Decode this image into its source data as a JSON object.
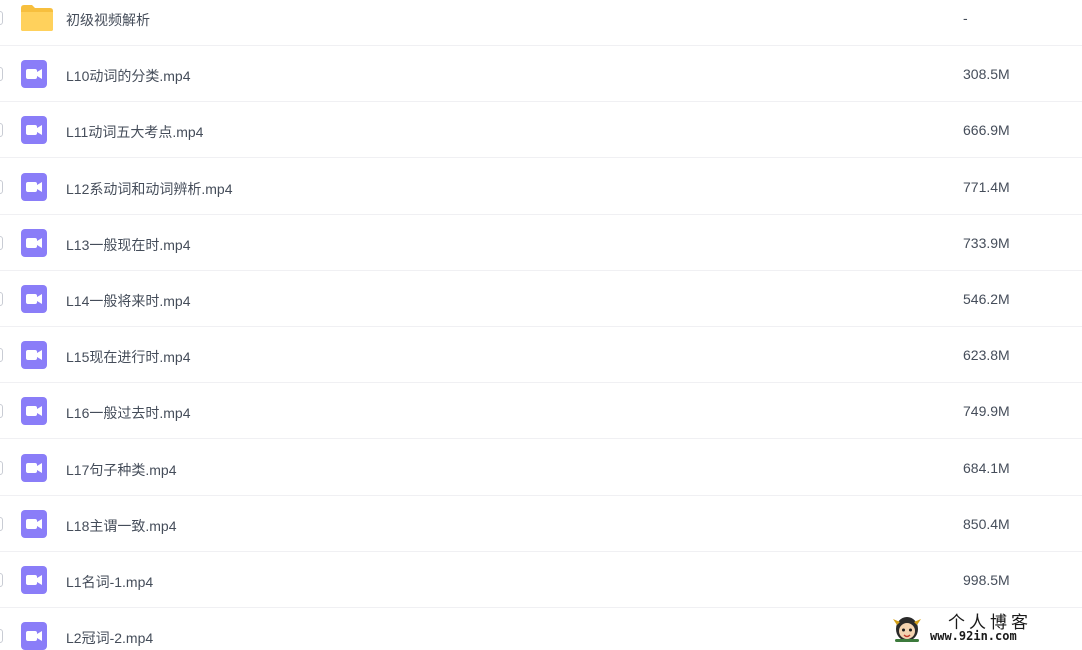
{
  "files": [
    {
      "name": "初级视频解析",
      "size": "-",
      "type": "folder",
      "icon": "folder-icon"
    },
    {
      "name": "L10动词的分类.mp4",
      "size": "308.5M",
      "type": "video",
      "icon": "video-file-icon"
    },
    {
      "name": "L11动词五大考点.mp4",
      "size": "666.9M",
      "type": "video",
      "icon": "video-file-icon"
    },
    {
      "name": "L12系动词和动词辨析.mp4",
      "size": "771.4M",
      "type": "video",
      "icon": "video-file-icon"
    },
    {
      "name": "L13一般现在时.mp4",
      "size": "733.9M",
      "type": "video",
      "icon": "video-file-icon"
    },
    {
      "name": "L14一般将来时.mp4",
      "size": "546.2M",
      "type": "video",
      "icon": "video-file-icon"
    },
    {
      "name": "L15现在进行时.mp4",
      "size": "623.8M",
      "type": "video",
      "icon": "video-file-icon"
    },
    {
      "name": "L16一般过去时.mp4",
      "size": "749.9M",
      "type": "video",
      "icon": "video-file-icon"
    },
    {
      "name": "L17句子种类.mp4",
      "size": "684.1M",
      "type": "video",
      "icon": "video-file-icon"
    },
    {
      "name": "L18主谓一致.mp4",
      "size": "850.4M",
      "type": "video",
      "icon": "video-file-icon"
    },
    {
      "name": "L1名词-1.mp4",
      "size": "998.5M",
      "type": "video",
      "icon": "video-file-icon"
    },
    {
      "name": "L2冠词-2.mp4",
      "size": "",
      "type": "video",
      "icon": "video-file-icon"
    }
  ],
  "watermark": {
    "title": "个人博客",
    "url": "www.92in.com"
  },
  "colors": {
    "folder": "#ffd15c",
    "folder_tab": "#f7bf3e",
    "video": "#8a7df8",
    "text": "#454d5a",
    "divider": "#f0f0f3"
  }
}
